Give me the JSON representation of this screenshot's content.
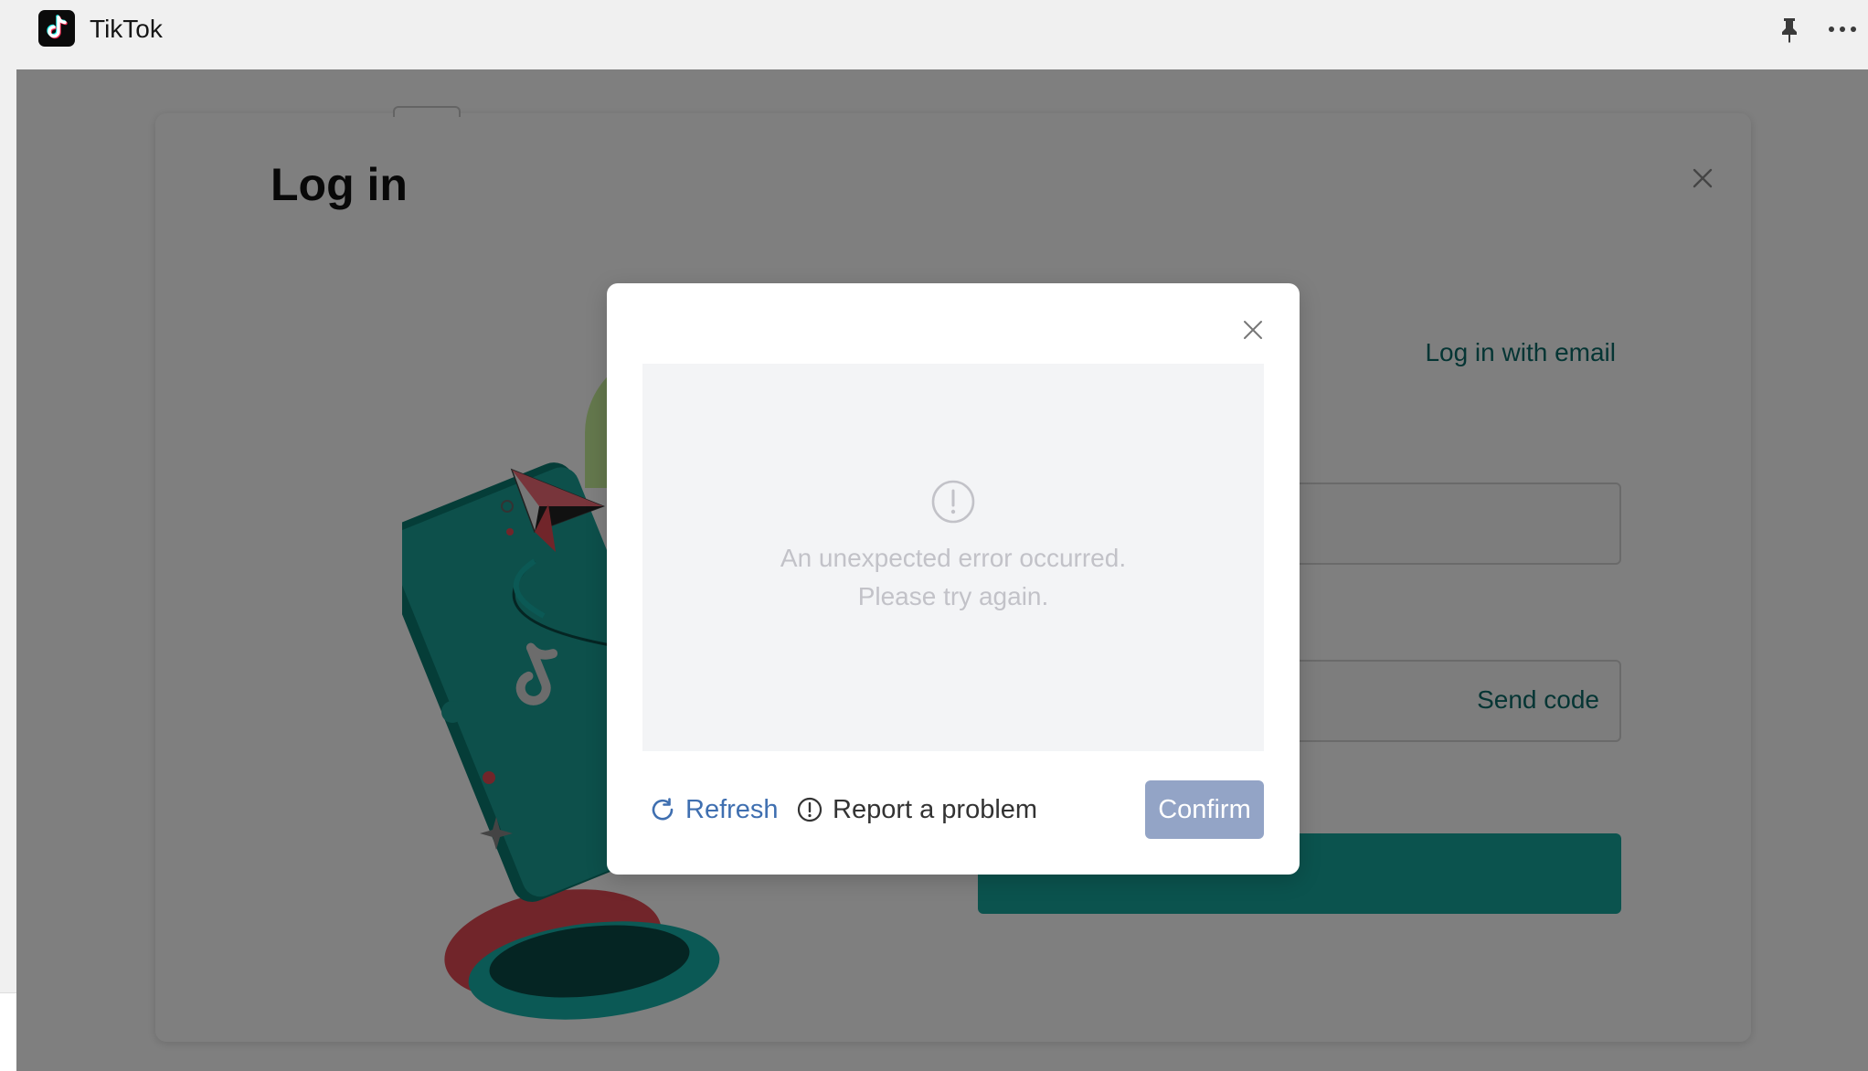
{
  "app": {
    "title": "TikTok",
    "icons": [
      "tiktok-logo",
      "pin-icon",
      "more-icon"
    ]
  },
  "login": {
    "title": "Log in",
    "email_link": "Log in with email",
    "send_code": "Send code"
  },
  "error_dialog": {
    "message": "An unexpected error occurred. Please try again.",
    "refresh_label": "Refresh",
    "report_label": "Report a problem",
    "confirm_label": "Confirm"
  },
  "colors": {
    "accent_teal": "#0b6b68",
    "submit_teal": "#17a79d",
    "link_blue": "#3f6fb0",
    "confirm_disabled": "#93a4c6",
    "error_text": "#c2c2c8"
  }
}
